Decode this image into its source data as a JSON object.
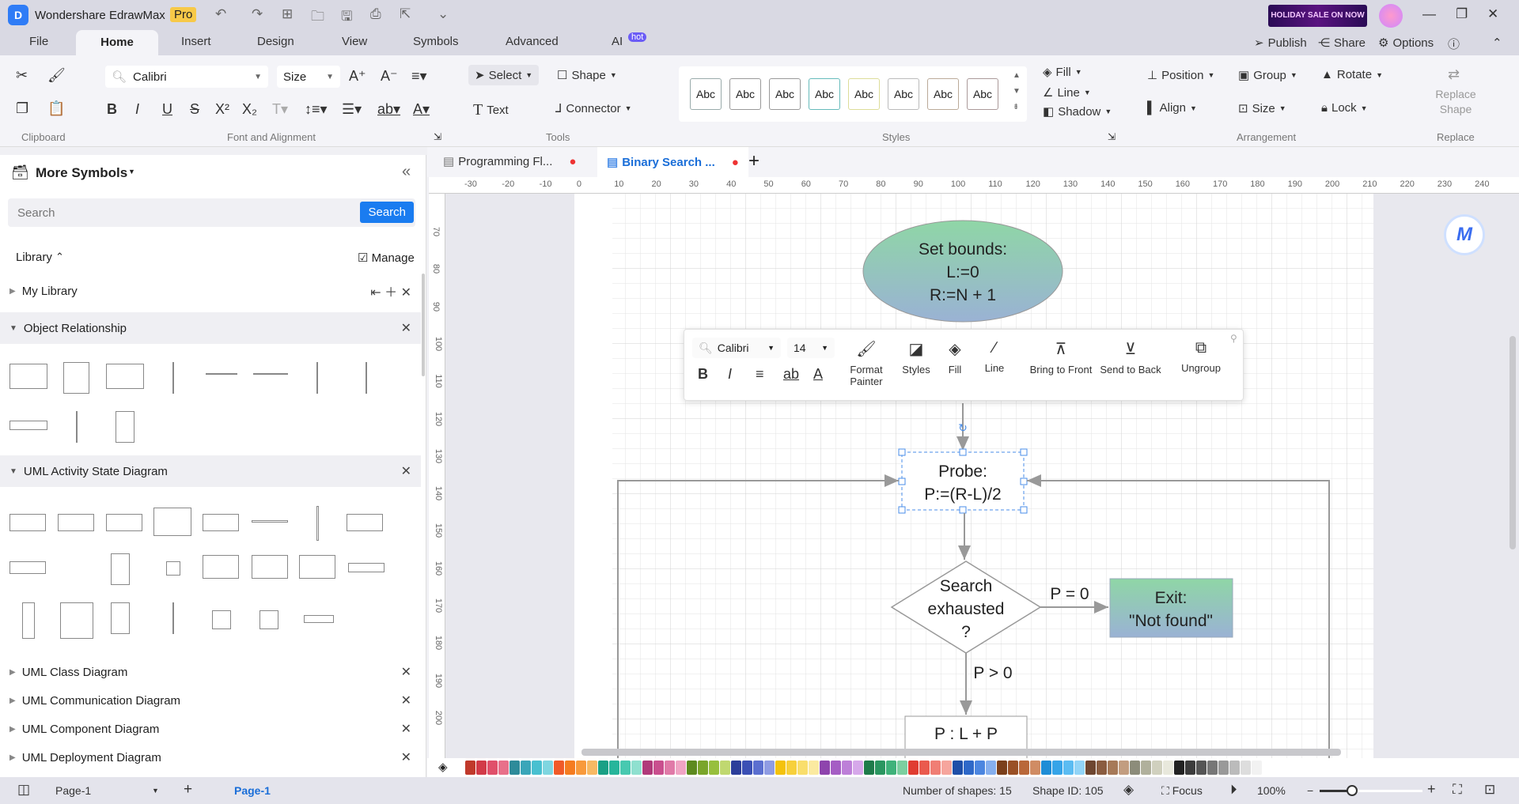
{
  "app": {
    "title": "Wondershare EdrawMax",
    "badge": "Pro",
    "sale": "HOLIDAY SALE ON NOW"
  },
  "menu": [
    "File",
    "Home",
    "Insert",
    "Design",
    "View",
    "Symbols",
    "Advanced",
    "AI"
  ],
  "ai_badge": "hot",
  "top_actions": {
    "publish": "Publish",
    "share": "Share",
    "options": "Options"
  },
  "ribbon": {
    "font": "Calibri",
    "size": "Size",
    "groups": {
      "clipboard": "Clipboard",
      "font": "Font and Alignment",
      "tools": "Tools",
      "styles": "Styles",
      "arrangement": "Arrangement",
      "replace": "Replace"
    },
    "tools": {
      "select": "Select",
      "shape": "Shape",
      "text": "Text",
      "connector": "Connector"
    },
    "style_sample": "Abc",
    "style_colors": [
      "#9aa",
      "#999",
      "#999",
      "#6bb",
      "#dd9",
      "#bbb",
      "#ba9",
      "#a99"
    ],
    "fill": "Fill",
    "line": "Line",
    "shadow": "Shadow",
    "position": "Position",
    "group": "Group",
    "rotate": "Rotate",
    "align": "Align",
    "lock": "Lock",
    "replace_shape": "Replace Shape"
  },
  "sidebar": {
    "title": "More Symbols",
    "search_placeholder": "Search",
    "search_button": "Search",
    "library": "Library",
    "manage": "Manage",
    "sections": [
      "My Library",
      "Object Relationship",
      "UML Activity State Diagram",
      "UML Class Diagram",
      "UML Communication Diagram",
      "UML Component Diagram",
      "UML Deployment Diagram"
    ]
  },
  "doc_tabs": [
    {
      "label": "Programming Fl..."
    },
    {
      "label": "Binary Search ..."
    }
  ],
  "ruler": {
    "h": [
      "-30",
      "-20",
      "-10",
      "0",
      "10",
      "20",
      "30",
      "40",
      "50",
      "60",
      "70",
      "80",
      "90",
      "100",
      "110",
      "120",
      "130",
      "140",
      "150",
      "160",
      "170",
      "180",
      "190",
      "200",
      "210",
      "220",
      "230",
      "240"
    ],
    "v": [
      "70",
      "80",
      "90",
      "100",
      "110",
      "120",
      "130",
      "140",
      "150",
      "160",
      "170",
      "180",
      "190",
      "200"
    ]
  },
  "float_toolbar": {
    "font": "Calibri",
    "size": "14",
    "format_painter": "Format Painter",
    "styles": "Styles",
    "fill": "Fill",
    "line": "Line",
    "bring_front": "Bring to Front",
    "send_back": "Send to Back",
    "ungroup": "Ungroup"
  },
  "diagram": {
    "start": [
      "Set bounds:",
      "L:=0",
      "R:=N + 1"
    ],
    "probe": [
      "Probe:",
      "P:=(R-L)/2"
    ],
    "decision": [
      "Search",
      "exhausted",
      "?"
    ],
    "exit": [
      "Exit:",
      "\"Not found\""
    ],
    "next": "P : L + P",
    "label_eq": "P = 0",
    "label_gt": "P > 0"
  },
  "palette": [
    "#c0392b",
    "#d23a48",
    "#e0506a",
    "#e8708a",
    "#2e8b9a",
    "#3aa6b9",
    "#49c0d0",
    "#7fd6e0",
    "#f05a28",
    "#f57c20",
    "#f89a3c",
    "#f7b964",
    "#1aa085",
    "#27b59b",
    "#48c9b0",
    "#8fe0cf",
    "#b03a7a",
    "#c94f8e",
    "#e07aa8",
    "#f0a4c4",
    "#5d8a1f",
    "#7aa52a",
    "#97bf3d",
    "#c0d870",
    "#2c3e9a",
    "#3b50b5",
    "#5b6fd0",
    "#8f9ce3",
    "#f4c20d",
    "#f7d03c",
    "#f9de6c",
    "#fbeaa0",
    "#8e44ad",
    "#a55ec4",
    "#bd7fd8",
    "#d6a8ea",
    "#1e7b4a",
    "#2a9660",
    "#3fb27a",
    "#7ccfa0",
    "#e03c31",
    "#ea5a4e",
    "#f07e74",
    "#f6a59d",
    "#1f4fa8",
    "#2e68c8",
    "#4c86e0",
    "#86afee",
    "#7b3f1a",
    "#9a5025",
    "#b9683a",
    "#d08c64",
    "#1f8dd6",
    "#36a4e8",
    "#5bbcf2",
    "#92d4f7",
    "#6e4630",
    "#8a5c40",
    "#a67958",
    "#c29d80",
    "#8c8c7a",
    "#b0b09c",
    "#d0d0be",
    "#e8e8dc",
    "#222222",
    "#3c3c3c",
    "#555555",
    "#777777",
    "#999999",
    "#bbbbbb",
    "#dddddd",
    "#f2f2f2"
  ],
  "status": {
    "page_select": "Page-1",
    "page_tab": "Page-1",
    "shapes": "Number of shapes: 15",
    "shape_id": "Shape ID: 105",
    "focus": "Focus",
    "zoom": "100%",
    "zoom_level": 100
  }
}
